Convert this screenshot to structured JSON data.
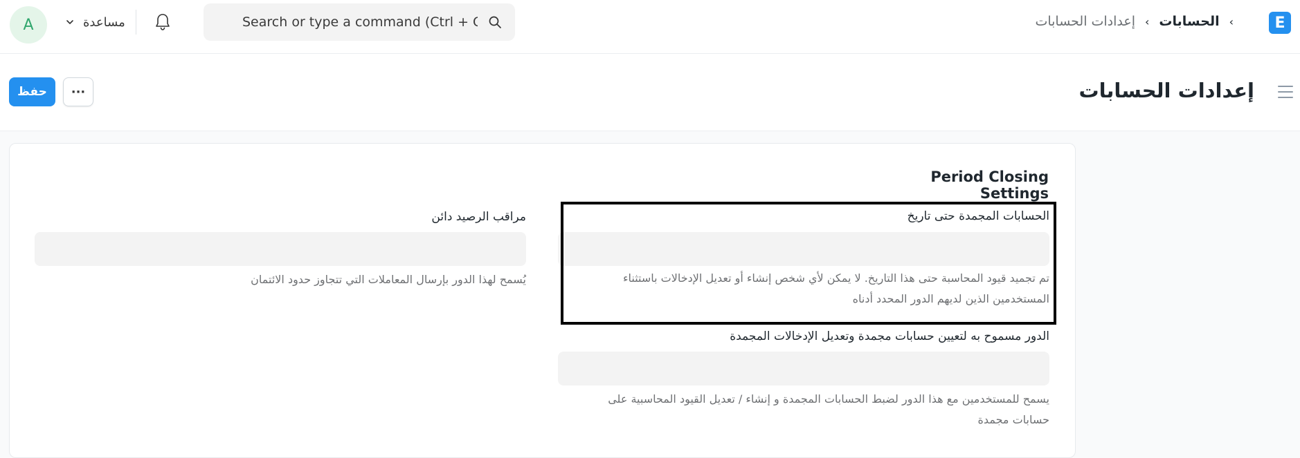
{
  "navbar": {
    "avatar_letter": "A",
    "help_label": "مساعدة",
    "search_placeholder": "Search or type a command (Ctrl + G)",
    "breadcrumbs": [
      "الحسابات",
      "إعدادات الحسابات"
    ],
    "logo_letter": "E"
  },
  "page": {
    "title": "إعدادات الحسابات",
    "save_label": "حفظ",
    "more_label": "···"
  },
  "section": {
    "title": "Period Closing Settings"
  },
  "fields": {
    "frozen_till": {
      "label": "الحسابات المجمدة حتى تاريخ",
      "description_line1": "تم تجميد قيود المحاسبة حتى هذا التاريخ. لا يمكن لأي شخص إنشاء أو تعديل الإدخالات باستثناء",
      "description_line2": "المستخدمين الذين لديهم الدور المحدد أدناه"
    },
    "frozen_role": {
      "label": "الدور مسموح به لتعيين حسابات مجمدة وتعديل الإدخالات المجمدة",
      "description_line1": "يسمح للمستخدمين مع هذا الدور لضبط الحسابات المجمدة و إنشاء / تعديل القيود المحاسبية على",
      "description_line2": "حسابات مجمدة"
    },
    "credit_controller": {
      "label": "مراقب الرصيد دائن",
      "description": "يُسمح لهذا الدور بإرسال المعاملات التي تتجاوز حدود الائتمان"
    }
  },
  "colors": {
    "primary": "#2490ef",
    "avatar_bg": "#e4f5e9",
    "avatar_fg": "#30a66d"
  }
}
